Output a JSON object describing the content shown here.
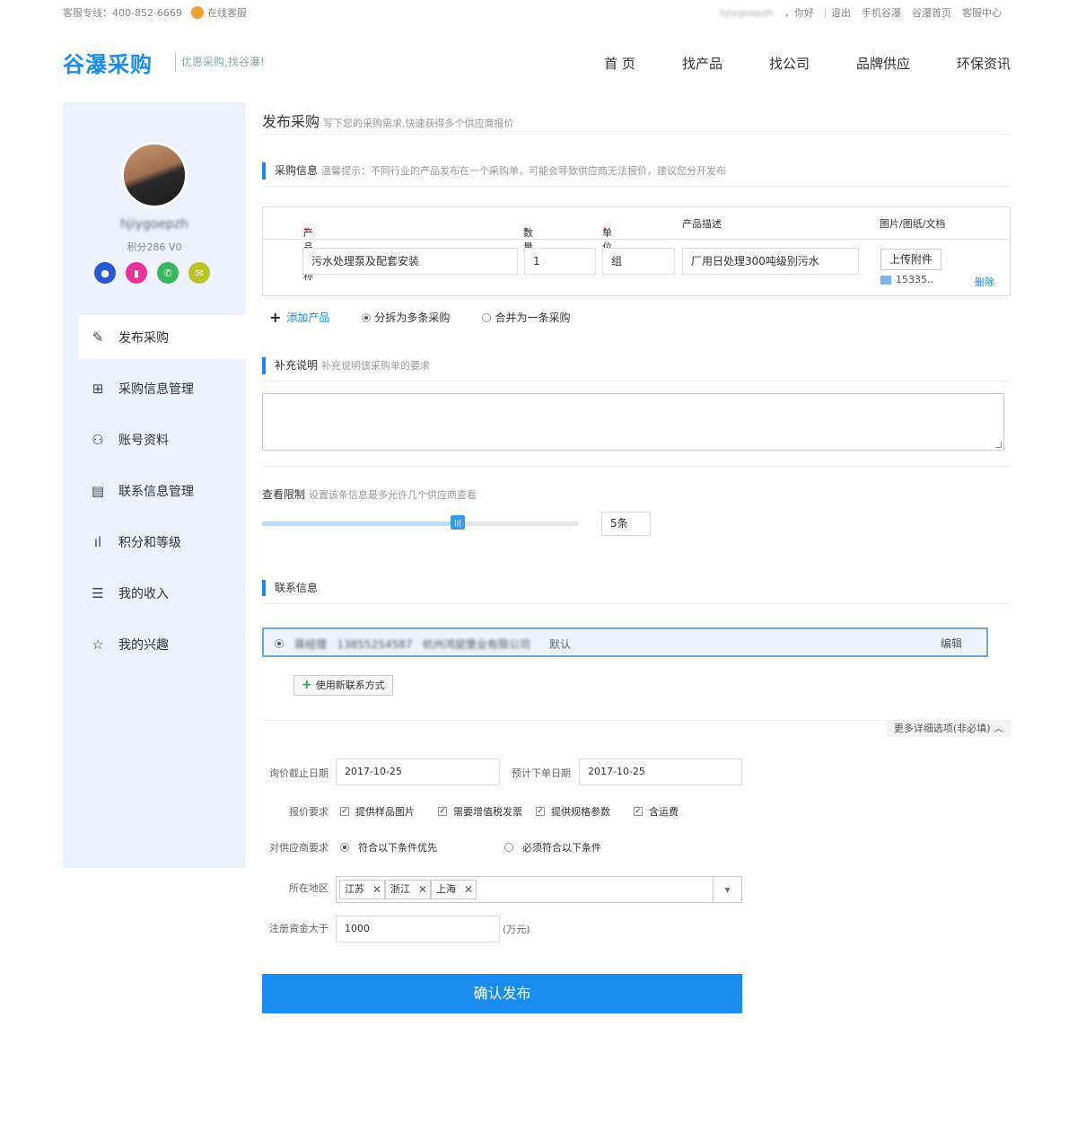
{
  "topbar": {
    "hotline": "客服专线：400-852-6669",
    "online_service": "在线客服",
    "username": "hjiygoepzh",
    "greeting": "，你好",
    "links": [
      "退出",
      "手机谷瀑",
      "谷瀑首页",
      "客服中心"
    ]
  },
  "header": {
    "logo": "谷瀑采购",
    "slogan": "优惠采购,找谷瀑!",
    "nav": [
      "首 页",
      "找产品",
      "找公司",
      "品牌供应",
      "环保资讯"
    ]
  },
  "sidebar": {
    "username": "hjiygoepzh",
    "points": "积分286 V0",
    "menu": [
      {
        "label": "发布采购",
        "icon": "edit-icon",
        "glyph": "✎"
      },
      {
        "label": "采购信息管理",
        "icon": "grid-icon",
        "glyph": "⊞"
      },
      {
        "label": "账号资料",
        "icon": "user-icon",
        "glyph": "⚇"
      },
      {
        "label": "联系信息管理",
        "icon": "contact-card-icon",
        "glyph": "▤"
      },
      {
        "label": "积分和等级",
        "icon": "bar-chart-icon",
        "glyph": "ıl"
      },
      {
        "label": "我的收入",
        "icon": "coins-icon",
        "glyph": "☰"
      },
      {
        "label": "我的兴趣",
        "icon": "star-icon",
        "glyph": "☆"
      }
    ]
  },
  "main": {
    "title": "发布采购",
    "title_hint": "写下您的采购需求,快速获得多个供应商报价",
    "purchase_info": {
      "title": "采购信息",
      "hint": "温馨提示：不同行业的产品发布在一个采购单，可能会导致供应商无法报价，建议您分开发布"
    },
    "table": {
      "headers": {
        "name": "产品名称",
        "qty": "数量",
        "unit": "单位",
        "desc": "产品描述",
        "files": "图片/图纸/文档"
      },
      "row": {
        "name": "污水处理泵及配套安装",
        "qty": "1",
        "unit": "组",
        "desc": "厂用日处理300吨级别污水",
        "upload": "上传附件",
        "file": "15335..",
        "delete": "删除"
      }
    },
    "add_product": "添加产品",
    "split_option": "分拆为多条采购",
    "merge_option": "合并为一条采购",
    "supplement": {
      "title": "补充说明",
      "hint": "补充说明该采购单的要求"
    },
    "view_limit": {
      "title": "查看限制",
      "hint": "设置该条信息最多允许几个供应商查看",
      "value": "5条",
      "fraction": 0.62
    },
    "contact": {
      "title": "联系信息",
      "name": "蒋经理",
      "phone": "13855254587",
      "company": "杭州鸿鼠堡业有限公司",
      "default": "默认",
      "edit": "编辑",
      "new_contact": "使用新联系方式"
    },
    "more_options": "更多详细选项(非必填)",
    "form": {
      "deadline_label": "询价截止日期",
      "deadline": "2017-10-25",
      "order_label": "预计下单日期",
      "order_date": "2017-10-25",
      "quote_label": "报价要求",
      "quote_reqs": [
        "提供样品图片",
        "需要增值税发票",
        "提供规格参数",
        "含运费"
      ],
      "supplier_label": "对供应商要求",
      "supplier_opt1": "符合以下条件优先",
      "supplier_opt2": "必须符合以下条件",
      "region_label": "所在地区",
      "regions": [
        "江苏",
        "浙江",
        "上海"
      ],
      "capital_label": "注册资金大于",
      "capital": "1000",
      "capital_unit": "(万元)"
    },
    "submit": "确认发布"
  },
  "colors": {
    "brand": "#1a8cf0",
    "sidebar_bg": "#edf2fd",
    "badge_blue": "#2a56d8",
    "badge_pink": "#e8339a",
    "badge_green": "#3cb85c",
    "badge_yellow": "#b9c52a"
  }
}
